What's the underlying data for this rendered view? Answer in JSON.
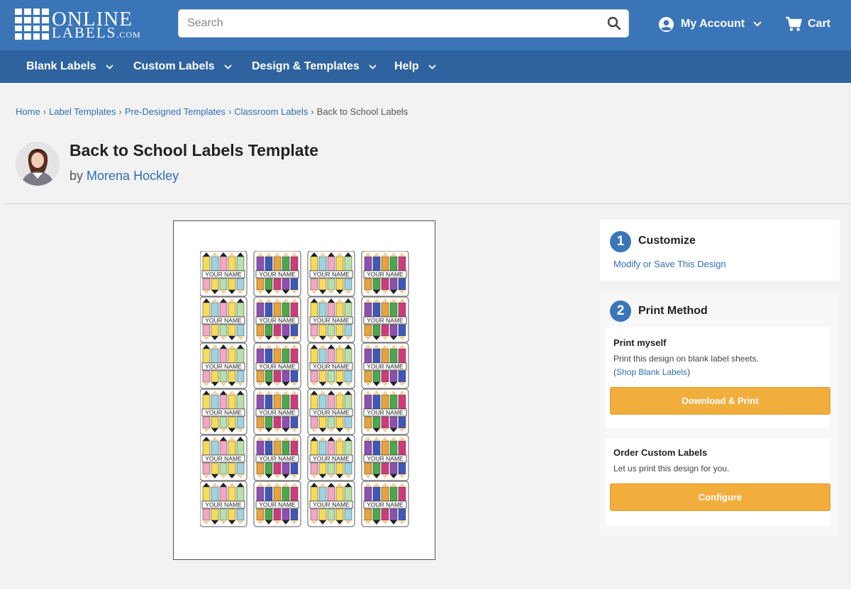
{
  "header": {
    "logo_top": "ONLINE",
    "logo_bottom": "LABELS",
    "logo_suffix": ".COM",
    "search_placeholder": "Search",
    "account_label": "My Account",
    "cart_label": "Cart"
  },
  "nav": {
    "items": [
      {
        "label": "Blank Labels"
      },
      {
        "label": "Custom Labels"
      },
      {
        "label": "Design & Templates"
      },
      {
        "label": "Help"
      }
    ]
  },
  "breadcrumb": {
    "items": [
      "Home",
      "Label Templates",
      "Pre-Designed Templates",
      "Classroom Labels"
    ],
    "current": "Back to School Labels",
    "separator": "›"
  },
  "page": {
    "title": "Back to School Labels Template",
    "by_prefix": "by",
    "author": "Morena Hockley"
  },
  "preview": {
    "label_text": "YOUR NAME",
    "rows": 6,
    "columns": 4
  },
  "customize": {
    "step": "1",
    "title": "Customize",
    "link": "Modify or Save This Design"
  },
  "print_method": {
    "step": "2",
    "title": "Print Method",
    "print_myself": {
      "heading": "Print myself",
      "text": "Print this design on blank label sheets.",
      "link_open": "(",
      "link": "Shop Blank Labels",
      "link_close": ")",
      "button": "Download & Print"
    },
    "order_custom": {
      "heading": "Order Custom Labels",
      "text": "Let us print this design for you.",
      "button": "Configure"
    }
  },
  "colors": {
    "header_blue": "#3a75b8",
    "nav_blue": "#2f639f",
    "link_blue": "#2f6fb5",
    "button_orange": "#f2ae3d"
  }
}
